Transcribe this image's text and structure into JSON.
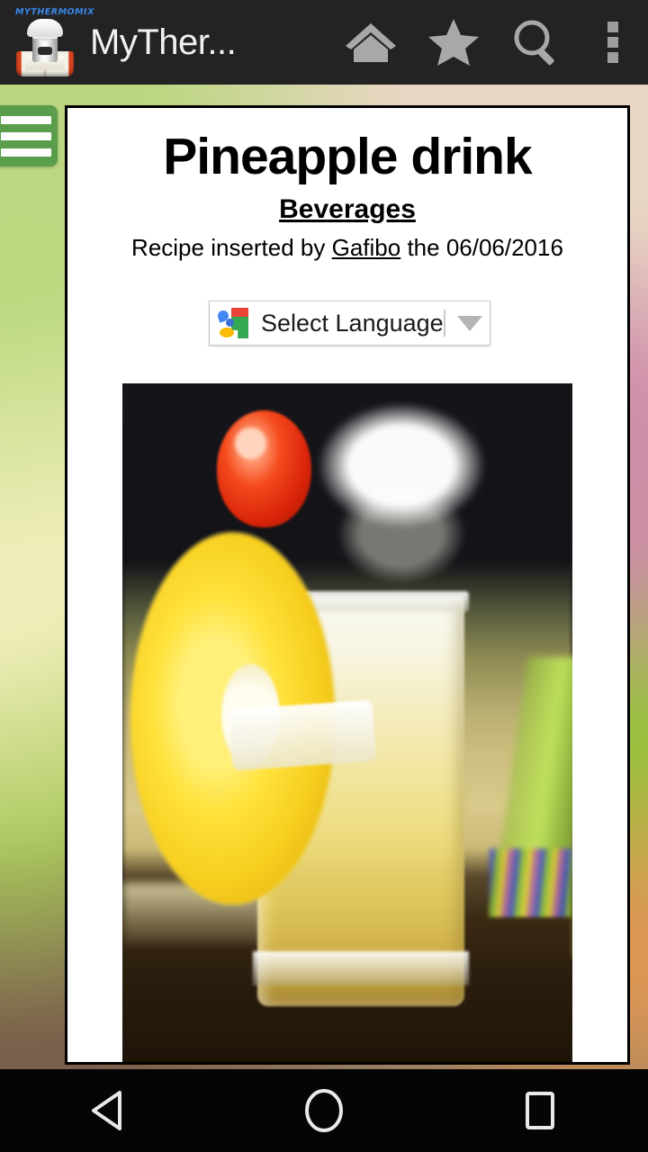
{
  "toolbar": {
    "app_title": "MyTher...",
    "logo_wordmark": "MYTHERMOMIX",
    "icons": {
      "logo": "app-logo-icon",
      "home": "home-icon",
      "favorites": "star-icon",
      "search": "search-icon",
      "overflow": "overflow-menu-icon"
    }
  },
  "drawer": {
    "icon": "hamburger-menu-icon"
  },
  "recipe": {
    "title": "Pineapple drink",
    "category": "Beverages",
    "meta_prefix": "Recipe inserted by ",
    "author": "Gafibo",
    "meta_middle": " the ",
    "date": "06/06/2016",
    "photo_alt": "Glass of pineapple drink with pineapple slice and cherry garnish"
  },
  "translate": {
    "label": "Select Language",
    "icon": "google-translate-icon",
    "arrow": "chevron-down-icon"
  },
  "navbar": {
    "back": "back-icon",
    "home": "home-circle-icon",
    "recents": "recents-square-icon"
  },
  "colors": {
    "toolbar_bg": "#232323",
    "drawer_green": "#5a9e4b",
    "card_bg": "#ffffff",
    "navbar_bg": "#050505",
    "icon_gray": "#a8a8a8"
  }
}
